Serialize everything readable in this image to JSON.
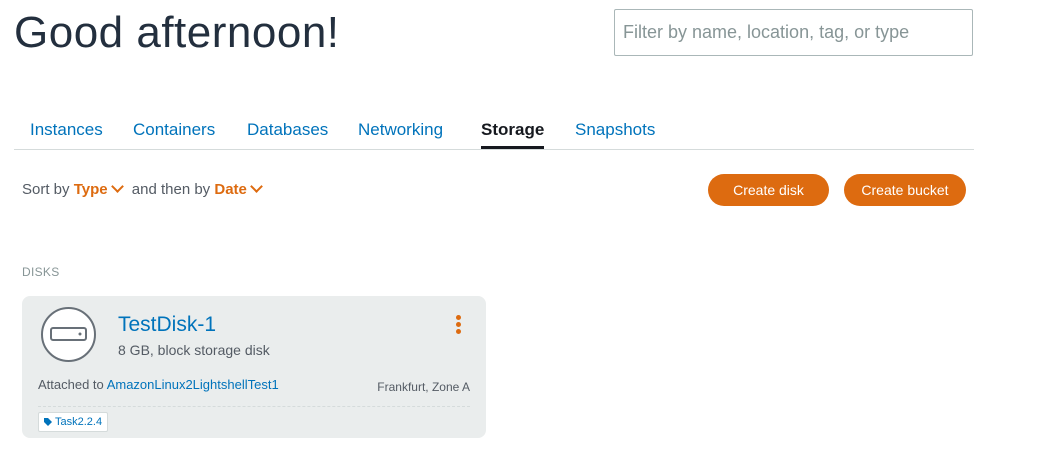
{
  "header": {
    "greeting": "Good afternoon!",
    "filter_placeholder": "Filter by name, location, tag, or type"
  },
  "tabs": [
    {
      "label": "Instances",
      "active": false
    },
    {
      "label": "Containers",
      "active": false
    },
    {
      "label": "Databases",
      "active": false
    },
    {
      "label": "Networking",
      "active": false
    },
    {
      "label": "Storage",
      "active": true
    },
    {
      "label": "Snapshots",
      "active": false
    }
  ],
  "sort": {
    "prefix": "Sort by",
    "first_value": "Type",
    "middle": "and then by",
    "second_value": "Date"
  },
  "actions": {
    "create_disk": "Create disk",
    "create_bucket": "Create bucket"
  },
  "disks_section": {
    "label": "DISKS",
    "items": [
      {
        "name": "TestDisk-1",
        "description": "8 GB, block storage disk",
        "attached_label": "Attached to",
        "attached_to": "AmazonLinux2LightshellTest1",
        "location": "Frankfurt, Zone A",
        "tag": "Task2.2.4"
      }
    ]
  },
  "colors": {
    "accent": "#dd6b10",
    "link": "#0073bb",
    "text": "#232f3e",
    "card_bg": "#eaeded"
  },
  "icons": [
    "block-storage-disk-icon",
    "kebab-menu-icon",
    "tag-icon",
    "chevron-down-icon"
  ]
}
